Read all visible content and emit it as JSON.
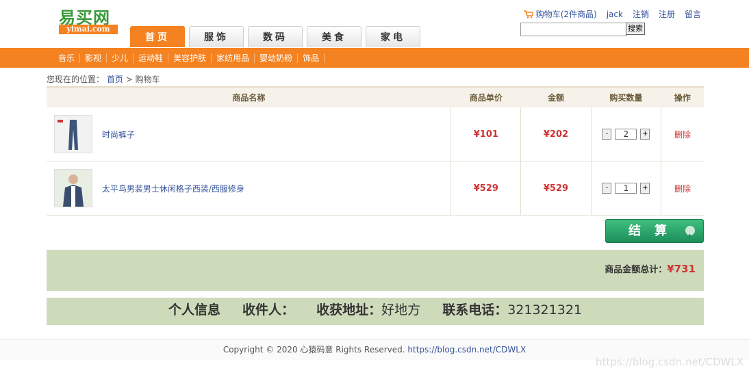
{
  "header": {
    "logo_cn": "易买网",
    "logo_en": "yimai.com",
    "tabs": [
      {
        "label": "首页"
      },
      {
        "label": "服饰"
      },
      {
        "label": "数码"
      },
      {
        "label": "美食"
      },
      {
        "label": "家电"
      }
    ],
    "top_links": {
      "cart": "购物车(2件商品)",
      "user": "jack",
      "logout": "注销",
      "register": "注册",
      "message": "留言"
    },
    "search": {
      "placeholder": "",
      "button": "搜索"
    },
    "categories": [
      "音乐",
      "影视",
      "少儿",
      "运动鞋",
      "美容护肤",
      "家纺用品",
      "婴幼奶粉",
      "饰品"
    ]
  },
  "breadcrumb": {
    "prefix": "您现在的位置：",
    "home": "首页",
    "sep": ">",
    "current": "购物车"
  },
  "cart": {
    "columns": [
      "商品名称",
      "商品单价",
      "金额",
      "购买数量",
      "操作"
    ],
    "rows": [
      {
        "name": "时尚裤子",
        "price": "¥101",
        "amount": "¥202",
        "qty": "2",
        "action": "删除",
        "minus": "-",
        "plus": "+"
      },
      {
        "name": "太平鸟男装男士休闲格子西装/西服修身",
        "price": "¥529",
        "amount": "¥529",
        "qty": "1",
        "action": "删除",
        "minus": "-",
        "plus": "+"
      }
    ],
    "checkout": "结算",
    "total_label": "商品金额总计：",
    "total_value": "¥731"
  },
  "info": {
    "title": "个人信息",
    "receiver_label": "收件人：",
    "receiver_value": "",
    "address_label": "收获地址：",
    "address_value": "好地方",
    "phone_label": "联系电话：",
    "phone_value": "321321321"
  },
  "footer": {
    "text": "Copyright © 2020 心猿码意 Rights Reserved.",
    "link": "https://blog.csdn.net/CDWLX"
  },
  "watermark": "https://blog.csdn.net/CDWLX",
  "colors": {
    "accent": "#f58220",
    "price": "#cc3333",
    "panel": "#cedbbb",
    "checkout": "#2aa86b"
  }
}
